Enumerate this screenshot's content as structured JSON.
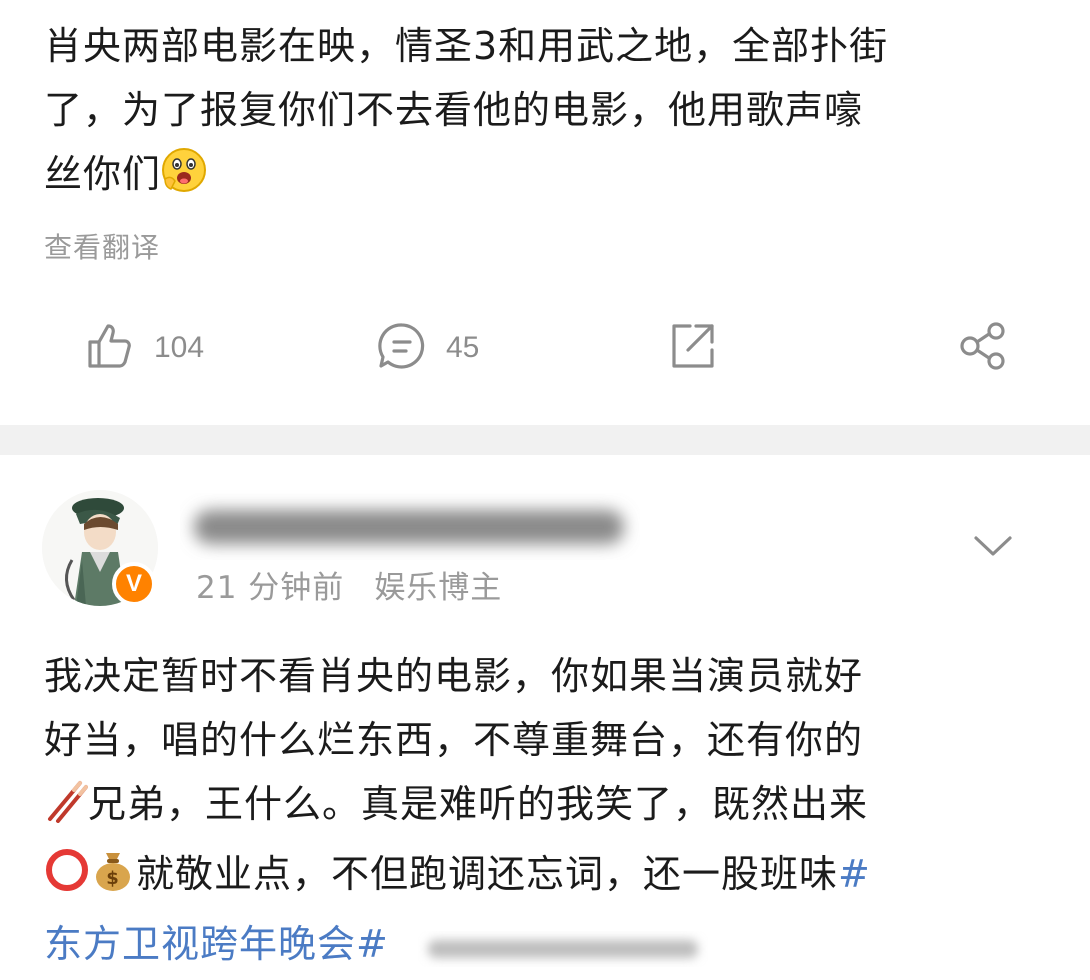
{
  "post1": {
    "text_line1": "肖央两部电影在映，情圣3和用武之地，全部扑街",
    "text_line2": "了，为了报复你们不去看他的电影，他用歌声嚎",
    "text_line3": "丝你们",
    "emoji_icon": "grinning-face-icon",
    "translate": "查看翻译",
    "actions": {
      "like_count": "104",
      "comment_count": "45"
    }
  },
  "post2": {
    "time": "21 分钟前",
    "badge_label": "娱乐博主",
    "verified_mark": "V",
    "line1": "我决定暂时不看肖央的电影，你如果当演员就好",
    "line2": "好当，唱的什么烂东西，不尊重舞台，还有你的",
    "line3_text": "兄弟，王什么。真是难听的我笑了，既然出来",
    "line4_text": "就敬业点，不但跑调还忘词，还一股班味",
    "hashtag_open": "#",
    "hashtag_text": "东方卫视跨年晚会#"
  },
  "colors": {
    "accent_link": "#4b7bc4",
    "verified_orange": "#ff8200",
    "muted": "#9a9a9a"
  }
}
